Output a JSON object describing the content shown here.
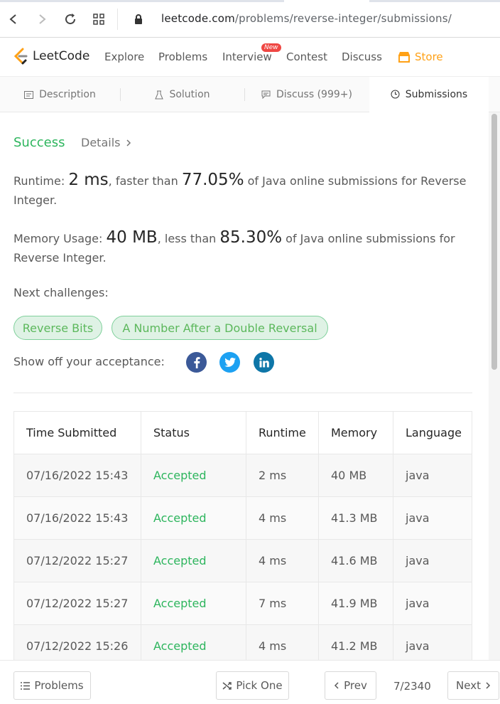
{
  "browser": {
    "url_domain": "leetcode.com",
    "url_path": "/problems/reverse-integer/submissions/"
  },
  "nav": {
    "logo": "LeetCode",
    "items": [
      "Explore",
      "Problems",
      "Interview",
      "Contest",
      "Discuss"
    ],
    "new_badge": "New",
    "store": "Store",
    "accent_color": "#ffa116"
  },
  "tabs": [
    {
      "label": "Description",
      "icon": "description-icon"
    },
    {
      "label": "Solution",
      "icon": "flask-icon"
    },
    {
      "label": "Discuss (999+)",
      "icon": "discuss-icon"
    },
    {
      "label": "Submissions",
      "icon": "clock-icon"
    }
  ],
  "result": {
    "status": "Success",
    "details": "Details",
    "runtime_label": "Runtime:",
    "runtime_value": "2 ms",
    "runtime_mid": ", faster than",
    "runtime_pct": "77.05%",
    "runtime_tail": "of Java online submissions for Reverse Integer.",
    "memory_label": "Memory Usage:",
    "memory_value": "40 MB",
    "memory_mid": ", less than",
    "memory_pct": "85.30%",
    "memory_tail": "of Java online submissions for Reverse Integer.",
    "success_color": "#2db55d"
  },
  "challenges": {
    "label": "Next challenges:",
    "items": [
      "Reverse Bits",
      "A Number After a Double Reversal"
    ]
  },
  "share": {
    "label": "Show off your acceptance:",
    "icons": [
      "facebook-icon",
      "twitter-icon",
      "linkedin-icon"
    ]
  },
  "table": {
    "headers": [
      "Time Submitted",
      "Status",
      "Runtime",
      "Memory",
      "Language"
    ],
    "rows": [
      [
        "07/16/2022 15:43",
        "Accepted",
        "2 ms",
        "40 MB",
        "java"
      ],
      [
        "07/16/2022 15:43",
        "Accepted",
        "4 ms",
        "41.3 MB",
        "java"
      ],
      [
        "07/12/2022 15:27",
        "Accepted",
        "4 ms",
        "41.6 MB",
        "java"
      ],
      [
        "07/12/2022 15:27",
        "Accepted",
        "7 ms",
        "41.9 MB",
        "java"
      ],
      [
        "07/12/2022 15:26",
        "Accepted",
        "4 ms",
        "41.2 MB",
        "java"
      ]
    ]
  },
  "footer": {
    "problems": "Problems",
    "pick_one": "Pick One",
    "prev": "Prev",
    "pager": "7/2340",
    "next": "Next"
  }
}
